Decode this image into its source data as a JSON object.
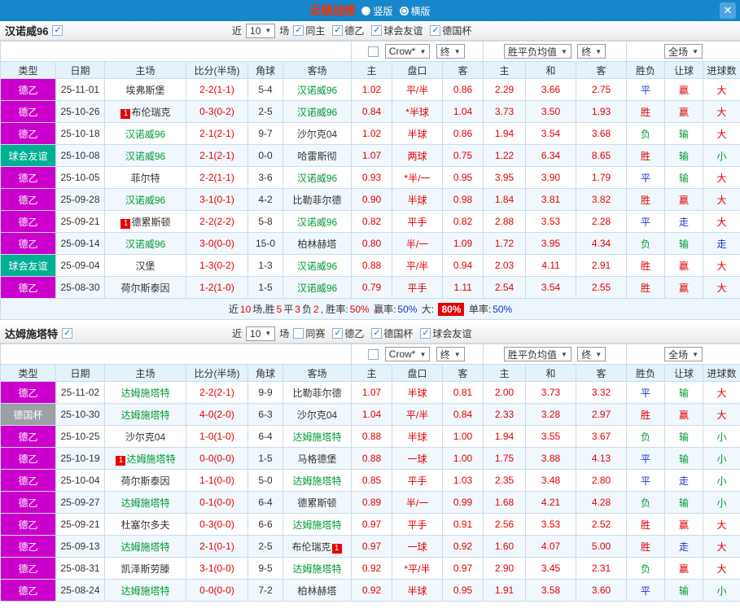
{
  "topbar": {
    "title": "近期战绩",
    "radio_vertical": "竖版",
    "radio_horizontal": "横版",
    "selected": "横版",
    "close_icon": "✕"
  },
  "colors": {
    "topbar": "#1886ca",
    "focal_team": "#009933",
    "score_red": "#e60000",
    "header_bg": "#e4f2fb",
    "border": "#c9dcea",
    "row_alt": "#f0f8fe",
    "badge_red": "#e60000"
  },
  "type_colors": {
    "dee2": "#cc00cc",
    "fri": "#00b093",
    "cup": "#9aa0a6"
  },
  "result_colors": {
    "r": "#e60000",
    "g": "#009933",
    "b": "#1a31d8"
  },
  "filter_bar": {
    "near": "近",
    "count": "10",
    "suffix": "场"
  },
  "table_head": {
    "type": "类型",
    "date": "日期",
    "home": "主场",
    "score": "比分(半场)",
    "corner": "角球",
    "away": "客场",
    "asia_home": "主",
    "asia_line": "盘口",
    "asia_away": "客",
    "eu_home": "主",
    "eu_draw": "和",
    "eu_away": "客",
    "wl": "胜负",
    "handicap": "让球",
    "goals": "进球数",
    "crow": "Crow*",
    "final": "终",
    "eu_mean": "胜平负均值",
    "full": "全场"
  },
  "sections": [
    {
      "team": "汉诺威96",
      "filters": [
        {
          "label": "同主",
          "checked": true
        },
        {
          "label": "德乙",
          "checked": true
        },
        {
          "label": "球会友谊",
          "checked": true
        },
        {
          "label": "德国杯",
          "checked": true
        }
      ],
      "rows": [
        {
          "type": "德乙",
          "tc": "dee2",
          "date": "25-11-01",
          "home": "埃弗斯堡",
          "score": "2-2(1-1)",
          "corner": "5-4",
          "away": "汉诺威96",
          "af": true,
          "o": [
            "1.02",
            "平/半",
            "0.86"
          ],
          "e": [
            "2.29",
            "3.66",
            "2.75"
          ],
          "res": [
            [
              "平",
              "b"
            ],
            [
              "赢",
              "r"
            ],
            [
              "大",
              "r"
            ]
          ]
        },
        {
          "type": "德乙",
          "tc": "dee2",
          "date": "25-10-26",
          "home": "布伦瑞克",
          "hb": "1",
          "score": "0-3(0-2)",
          "corner": "2-5",
          "away": "汉诺威96",
          "af": true,
          "o": [
            "0.84",
            "*半球",
            "1.04"
          ],
          "e": [
            "3.73",
            "3.50",
            "1.93"
          ],
          "res": [
            [
              "胜",
              "r"
            ],
            [
              "赢",
              "r"
            ],
            [
              "大",
              "r"
            ]
          ]
        },
        {
          "type": "德乙",
          "tc": "dee2",
          "date": "25-10-18",
          "home": "汉诺威96",
          "hf": true,
          "score": "2-1(2-1)",
          "corner": "9-7",
          "away": "沙尔克04",
          "o": [
            "1.02",
            "半球",
            "0.86"
          ],
          "e": [
            "1.94",
            "3.54",
            "3.68"
          ],
          "res": [
            [
              "负",
              "g"
            ],
            [
              "输",
              "g"
            ],
            [
              "大",
              "r"
            ]
          ]
        },
        {
          "type": "球会友谊",
          "tc": "fri",
          "date": "25-10-08",
          "home": "汉诺威96",
          "hf": true,
          "score": "2-1(2-1)",
          "corner": "0-0",
          "away": "哈雷斯彻",
          "o": [
            "1.07",
            "两球",
            "0.75"
          ],
          "e": [
            "1.22",
            "6.34",
            "8.65"
          ],
          "res": [
            [
              "胜",
              "r"
            ],
            [
              "输",
              "g"
            ],
            [
              "小",
              "g"
            ]
          ]
        },
        {
          "type": "德乙",
          "tc": "dee2",
          "date": "25-10-05",
          "home": "菲尔特",
          "score": "2-2(1-1)",
          "corner": "3-6",
          "away": "汉诺威96",
          "af": true,
          "o": [
            "0.93",
            "*半/一",
            "0.95"
          ],
          "e": [
            "3.95",
            "3.90",
            "1.79"
          ],
          "res": [
            [
              "平",
              "b"
            ],
            [
              "输",
              "g"
            ],
            [
              "大",
              "r"
            ]
          ]
        },
        {
          "type": "德乙",
          "tc": "dee2",
          "date": "25-09-28",
          "home": "汉诺威96",
          "hf": true,
          "score": "3-1(0-1)",
          "corner": "4-2",
          "away": "比勒菲尔德",
          "o": [
            "0.90",
            "半球",
            "0.98"
          ],
          "e": [
            "1.84",
            "3.81",
            "3.82"
          ],
          "res": [
            [
              "胜",
              "r"
            ],
            [
              "赢",
              "r"
            ],
            [
              "大",
              "r"
            ]
          ]
        },
        {
          "type": "德乙",
          "tc": "dee2",
          "date": "25-09-21",
          "home": "德累斯顿",
          "hb": "1",
          "score": "2-2(2-2)",
          "corner": "5-8",
          "away": "汉诺威96",
          "af": true,
          "o": [
            "0.82",
            "平手",
            "0.82"
          ],
          "e": [
            "2.88",
            "3.53",
            "2.28"
          ],
          "res": [
            [
              "平",
              "b"
            ],
            [
              "走",
              "b"
            ],
            [
              "大",
              "r"
            ]
          ]
        },
        {
          "type": "德乙",
          "tc": "dee2",
          "date": "25-09-14",
          "home": "汉诺威96",
          "hf": true,
          "score": "3-0(0-0)",
          "corner": "15-0",
          "away": "柏林赫塔",
          "o": [
            "0.80",
            "半/一",
            "1.09"
          ],
          "e": [
            "1.72",
            "3.95",
            "4.34"
          ],
          "res": [
            [
              "负",
              "g"
            ],
            [
              "输",
              "g"
            ],
            [
              "走",
              "b"
            ]
          ]
        },
        {
          "type": "球会友谊",
          "tc": "fri",
          "date": "25-09-04",
          "home": "汉堡",
          "score": "1-3(0-2)",
          "corner": "1-3",
          "away": "汉诺威96",
          "af": true,
          "o": [
            "0.88",
            "平/半",
            "0.94"
          ],
          "e": [
            "2.03",
            "4.11",
            "2.91"
          ],
          "res": [
            [
              "胜",
              "r"
            ],
            [
              "赢",
              "r"
            ],
            [
              "大",
              "r"
            ]
          ]
        },
        {
          "type": "德乙",
          "tc": "dee2",
          "date": "25-08-30",
          "home": "荷尔斯泰因",
          "score": "1-2(1-0)",
          "corner": "1-5",
          "away": "汉诺威96",
          "af": true,
          "o": [
            "0.79",
            "平手",
            "1.11"
          ],
          "e": [
            "2.54",
            "3.54",
            "2.55"
          ],
          "res": [
            [
              "胜",
              "r"
            ],
            [
              "赢",
              "r"
            ],
            [
              "大",
              "r"
            ]
          ]
        }
      ],
      "summary": [
        {
          "t": "近",
          "c": "#333333"
        },
        {
          "t": "10",
          "c": "#e60000"
        },
        {
          "t": "场,胜",
          "c": "#333333"
        },
        {
          "t": "5",
          "c": "#e60000"
        },
        {
          "t": "平",
          "c": "#333333"
        },
        {
          "t": "3",
          "c": "#e60000"
        },
        {
          "t": "负",
          "c": "#333333"
        },
        {
          "t": "2",
          "c": "#e60000"
        },
        {
          "t": ", 胜率:",
          "c": "#333333"
        },
        {
          "t": "50%",
          "c": "#e60000"
        },
        {
          "t": " 赢率:",
          "c": "#333333"
        },
        {
          "t": "50%",
          "c": "#1a31d8"
        },
        {
          "t": " 大: ",
          "c": "#333333"
        },
        {
          "t": "80%",
          "c": "#ffffff",
          "bg": "#e60000"
        },
        {
          "t": " 单率:",
          "c": "#333333"
        },
        {
          "t": "50%",
          "c": "#1a31d8"
        }
      ]
    },
    {
      "team": "达姆施塔特",
      "filters": [
        {
          "label": "同赛",
          "checked": false
        },
        {
          "label": "德乙",
          "checked": true
        },
        {
          "label": "德国杯",
          "checked": true
        },
        {
          "label": "球会友谊",
          "checked": true
        }
      ],
      "rows": [
        {
          "type": "德乙",
          "tc": "dee2",
          "date": "25-11-02",
          "home": "达姆施塔特",
          "hf": true,
          "score": "2-2(2-1)",
          "corner": "9-9",
          "away": "比勒菲尔德",
          "o": [
            "1.07",
            "半球",
            "0.81"
          ],
          "e": [
            "2.00",
            "3.73",
            "3.32"
          ],
          "res": [
            [
              "平",
              "b"
            ],
            [
              "输",
              "g"
            ],
            [
              "大",
              "r"
            ]
          ]
        },
        {
          "type": "德国杯",
          "tc": "cup",
          "date": "25-10-30",
          "home": "达姆施塔特",
          "hf": true,
          "score": "4-0(2-0)",
          "corner": "6-3",
          "away": "沙尔克04",
          "o": [
            "1.04",
            "平/半",
            "0.84"
          ],
          "e": [
            "2.33",
            "3.28",
            "2.97"
          ],
          "res": [
            [
              "胜",
              "r"
            ],
            [
              "赢",
              "r"
            ],
            [
              "大",
              "r"
            ]
          ]
        },
        {
          "type": "德乙",
          "tc": "dee2",
          "date": "25-10-25",
          "home": "沙尔克04",
          "score": "1-0(1-0)",
          "corner": "6-4",
          "away": "达姆施塔特",
          "af": true,
          "o": [
            "0.88",
            "半球",
            "1.00"
          ],
          "e": [
            "1.94",
            "3.55",
            "3.67"
          ],
          "res": [
            [
              "负",
              "g"
            ],
            [
              "输",
              "g"
            ],
            [
              "小",
              "g"
            ]
          ]
        },
        {
          "type": "德乙",
          "tc": "dee2",
          "date": "25-10-19",
          "home": "达姆施塔特",
          "hf": true,
          "hb": "1",
          "score": "0-0(0-0)",
          "corner": "1-5",
          "away": "马格德堡",
          "o": [
            "0.88",
            "一球",
            "1.00"
          ],
          "e": [
            "1.75",
            "3.88",
            "4.13"
          ],
          "res": [
            [
              "平",
              "b"
            ],
            [
              "输",
              "g"
            ],
            [
              "小",
              "g"
            ]
          ]
        },
        {
          "type": "德乙",
          "tc": "dee2",
          "date": "25-10-04",
          "home": "荷尔斯泰因",
          "score": "1-1(0-0)",
          "corner": "5-0",
          "away": "达姆施塔特",
          "af": true,
          "o": [
            "0.85",
            "平手",
            "1.03"
          ],
          "e": [
            "2.35",
            "3.48",
            "2.80"
          ],
          "res": [
            [
              "平",
              "b"
            ],
            [
              "走",
              "b"
            ],
            [
              "小",
              "g"
            ]
          ]
        },
        {
          "type": "德乙",
          "tc": "dee2",
          "date": "25-09-27",
          "home": "达姆施塔特",
          "hf": true,
          "score": "0-1(0-0)",
          "corner": "6-4",
          "away": "德累斯顿",
          "o": [
            "0.89",
            "半/一",
            "0.99"
          ],
          "e": [
            "1.68",
            "4.21",
            "4.28"
          ],
          "res": [
            [
              "负",
              "g"
            ],
            [
              "输",
              "g"
            ],
            [
              "小",
              "g"
            ]
          ]
        },
        {
          "type": "德乙",
          "tc": "dee2",
          "date": "25-09-21",
          "home": "杜塞尔多夫",
          "score": "0-3(0-0)",
          "corner": "6-6",
          "away": "达姆施塔特",
          "af": true,
          "o": [
            "0.97",
            "平手",
            "0.91"
          ],
          "e": [
            "2.56",
            "3.53",
            "2.52"
          ],
          "res": [
            [
              "胜",
              "r"
            ],
            [
              "赢",
              "r"
            ],
            [
              "大",
              "r"
            ]
          ]
        },
        {
          "type": "德乙",
          "tc": "dee2",
          "date": "25-09-13",
          "home": "达姆施塔特",
          "hf": true,
          "score": "2-1(0-1)",
          "corner": "2-5",
          "away": "布伦瑞克",
          "ab": "1",
          "o": [
            "0.97",
            "一球",
            "0.92"
          ],
          "e": [
            "1.60",
            "4.07",
            "5.00"
          ],
          "res": [
            [
              "胜",
              "r"
            ],
            [
              "走",
              "b"
            ],
            [
              "大",
              "r"
            ]
          ]
        },
        {
          "type": "德乙",
          "tc": "dee2",
          "date": "25-08-31",
          "home": "凯泽斯劳滕",
          "score": "3-1(0-0)",
          "corner": "9-5",
          "away": "达姆施塔特",
          "af": true,
          "o": [
            "0.92",
            "*平/半",
            "0.97"
          ],
          "e": [
            "2.90",
            "3.45",
            "2.31"
          ],
          "res": [
            [
              "负",
              "g"
            ],
            [
              "赢",
              "r"
            ],
            [
              "大",
              "r"
            ]
          ]
        },
        {
          "type": "德乙",
          "tc": "dee2",
          "date": "25-08-24",
          "home": "达姆施塔特",
          "hf": true,
          "score": "0-0(0-0)",
          "corner": "7-2",
          "away": "柏林赫塔",
          "o": [
            "0.92",
            "半球",
            "0.95"
          ],
          "e": [
            "1.91",
            "3.58",
            "3.60"
          ],
          "res": [
            [
              "平",
              "b"
            ],
            [
              "输",
              "g"
            ],
            [
              "小",
              "g"
            ]
          ]
        }
      ]
    }
  ]
}
